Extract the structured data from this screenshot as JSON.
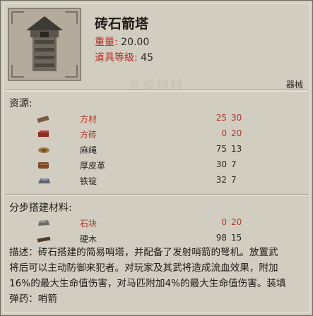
{
  "item": {
    "title": "砖石箭塔",
    "weight_label": "重量:",
    "weight_value": "20.00",
    "level_label": "道具等级:",
    "level_value": "45",
    "category": "器械",
    "watermark": "合成材料"
  },
  "resources": {
    "title": "资源:",
    "items": [
      {
        "name": "方材",
        "have": "25",
        "need": "30",
        "enough": false,
        "icon": "square-timber-icon"
      },
      {
        "name": "方砖",
        "have": "0",
        "need": "20",
        "enough": false,
        "icon": "brick-icon"
      },
      {
        "name": "麻绳",
        "have": "75",
        "need": "13",
        "enough": true,
        "icon": "hemp-rope-icon"
      },
      {
        "name": "厚皮革",
        "have": "30",
        "need": "7",
        "enough": true,
        "icon": "thick-leather-icon"
      },
      {
        "name": "铁锭",
        "have": "32",
        "need": "7",
        "enough": true,
        "icon": "iron-ingot-icon"
      }
    ]
  },
  "stage_materials": {
    "title": "分步搭建材料:",
    "items": [
      {
        "name": "石块",
        "have": "0",
        "need": "20",
        "enough": false,
        "icon": "stone-block-icon"
      },
      {
        "name": "硬木",
        "have": "98",
        "need": "15",
        "enough": true,
        "icon": "hardwood-icon"
      }
    ]
  },
  "description": {
    "lines": [
      "描述：砖石搭建的简易哨塔，并配备了发射哨箭的弩机。放置武",
      "将后可以主动防御来犯者。对玩家及其武将造成流血效果，附加",
      "16%的最大生命值伤害，对马匹附加4%的最大生命值伤害。装填",
      "弹药：哨箭"
    ]
  },
  "colors": {
    "panel": "#d2cdc1",
    "label_red": "#b52a23",
    "insufficient": "#a83a2c",
    "text": "#1e1c19"
  }
}
